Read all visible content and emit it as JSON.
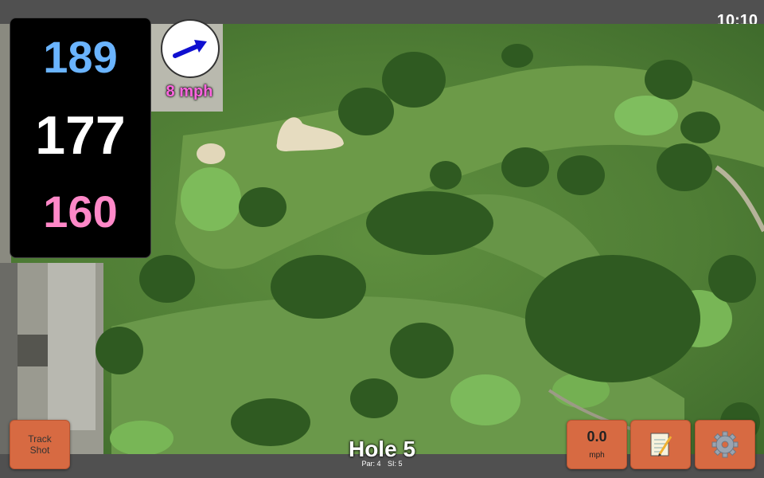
{
  "status_bar": {
    "time": "10:10"
  },
  "distances": {
    "back": "189",
    "middle": "177",
    "front": "160"
  },
  "wind": {
    "speed": "8 mph",
    "direction_icon": "wind-arrow-icon"
  },
  "hole": {
    "title": "Hole 5",
    "par": "Par: 4",
    "stroke_index": "SI: 5"
  },
  "buttons": {
    "track_shot_line1": "Track",
    "track_shot_line2": "Shot",
    "speed_value": "0.0",
    "speed_unit": "mph",
    "notes_icon": "notepad-icon",
    "settings_icon": "gear-icon"
  },
  "colors": {
    "back_distance": "#6ab4ff",
    "middle_distance": "#ffffff",
    "front_distance": "#ff88c8",
    "wind_text": "#ff66e0",
    "button": "#d76a42"
  }
}
